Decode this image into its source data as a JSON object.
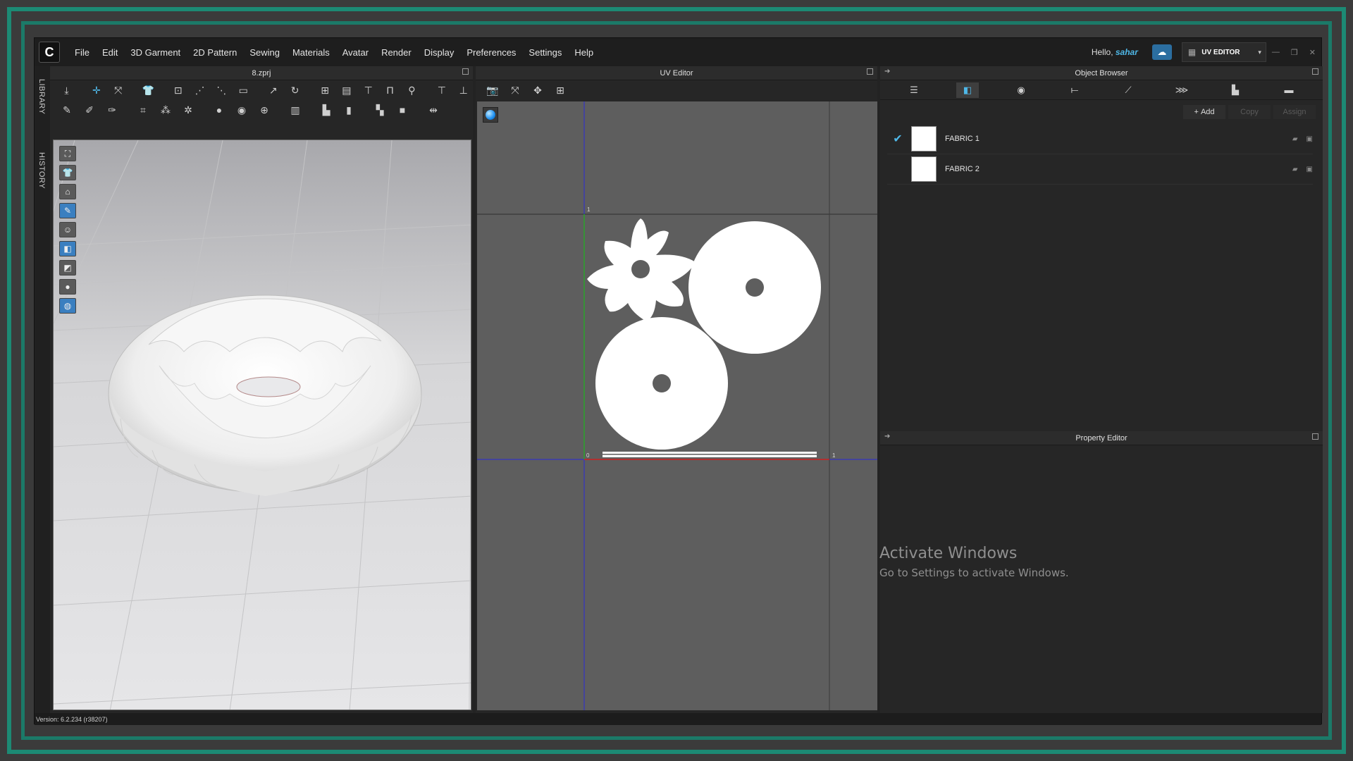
{
  "menubar": {
    "logo": "C",
    "items": [
      "File",
      "Edit",
      "3D Garment",
      "2D Pattern",
      "Sewing",
      "Materials",
      "Avatar",
      "Render",
      "Display",
      "Preferences",
      "Settings",
      "Help"
    ],
    "hello_prefix": "Hello,",
    "username": "sahar",
    "mode_label": "UV EDITOR"
  },
  "side_tabs": {
    "library": "LIBRARY",
    "history": "HISTORY"
  },
  "view3d": {
    "title": "8.zprj"
  },
  "uv_editor": {
    "title": "UV Editor",
    "axis_labels": {
      "top_one": "1",
      "origin": "0",
      "right_one": "1"
    }
  },
  "object_browser": {
    "title": "Object Browser",
    "add_label": "Add",
    "copy_label": "Copy",
    "assign_label": "Assign",
    "fabrics": [
      {
        "name": "FABRIC 1",
        "checked": true,
        "color": "#ffffff"
      },
      {
        "name": "FABRIC 2",
        "checked": false,
        "color": "#ffffff"
      }
    ]
  },
  "property_editor": {
    "title": "Property Editor"
  },
  "watermark": {
    "line1": "Activate Windows",
    "line2": "Go to Settings to activate Windows."
  },
  "status": {
    "version": "Version: 6.2.234 (r38207)"
  },
  "colors": {
    "accent": "#4fb8e8",
    "frame": "#1c8a74",
    "uv_bg": "#5e5e5e"
  }
}
